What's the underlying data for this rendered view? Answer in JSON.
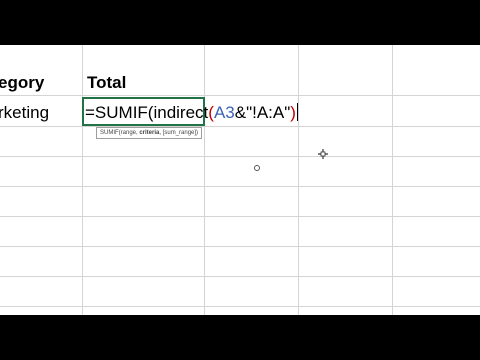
{
  "sheet": {
    "header_row": {
      "category": "egory",
      "total": "Total"
    },
    "data_row": {
      "category": "rketing"
    },
    "active_cell": {
      "formula_prefix": "=SUMIF(indirect",
      "open_paren": "(",
      "reference": "A3",
      "suffix": "&\"!A:A\"",
      "close_paren": ")"
    },
    "tooltip": {
      "func": "SUMIF(range, ",
      "current_arg": "criteria",
      "rest": ", [sum_range])"
    }
  },
  "colors": {
    "reference": "#3e63b8",
    "paren": "#c00000",
    "cell_border": "#217346",
    "grid": "#d4d4d4"
  }
}
